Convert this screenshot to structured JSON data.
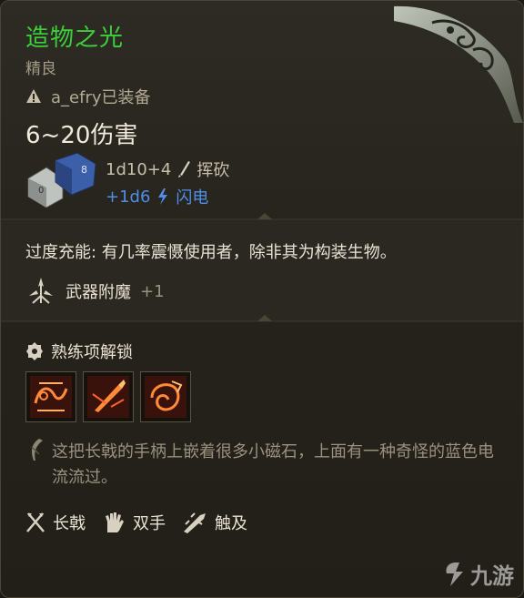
{
  "item": {
    "name": "造物之光",
    "rarity": "精良",
    "equipped_by": "a_efry已装备",
    "damage": "6~20伤害",
    "roll_main": "1d10+4",
    "damage_type_main": "挥砍",
    "roll_bonus": "+1d6",
    "damage_type_bonus": "闪电"
  },
  "passive": {
    "text": "过度充能: 有几率震慑使用者，除非其为构装生物。"
  },
  "enchant": {
    "label": "武器附魔",
    "value": "+1"
  },
  "proficiency": {
    "label": "熟练项解锁",
    "skills": [
      {
        "icon": "tether-slash-icon"
      },
      {
        "icon": "lacerate-icon"
      },
      {
        "icon": "rush-attack-icon"
      }
    ]
  },
  "lore": "这把长戟的手柄上嵌着很多小磁石，上面有一种奇怪的蓝色电流流过。",
  "properties": [
    {
      "icon": "halberd-icon",
      "label": "长戟"
    },
    {
      "icon": "two-handed-icon",
      "label": "双手"
    },
    {
      "icon": "reach-icon",
      "label": "触及"
    }
  ],
  "watermark": "九游",
  "colors": {
    "name": "#3ccf3c",
    "bonus_damage": "#4f8fe8",
    "text": "#eae2d2",
    "muted": "#9a917f"
  }
}
